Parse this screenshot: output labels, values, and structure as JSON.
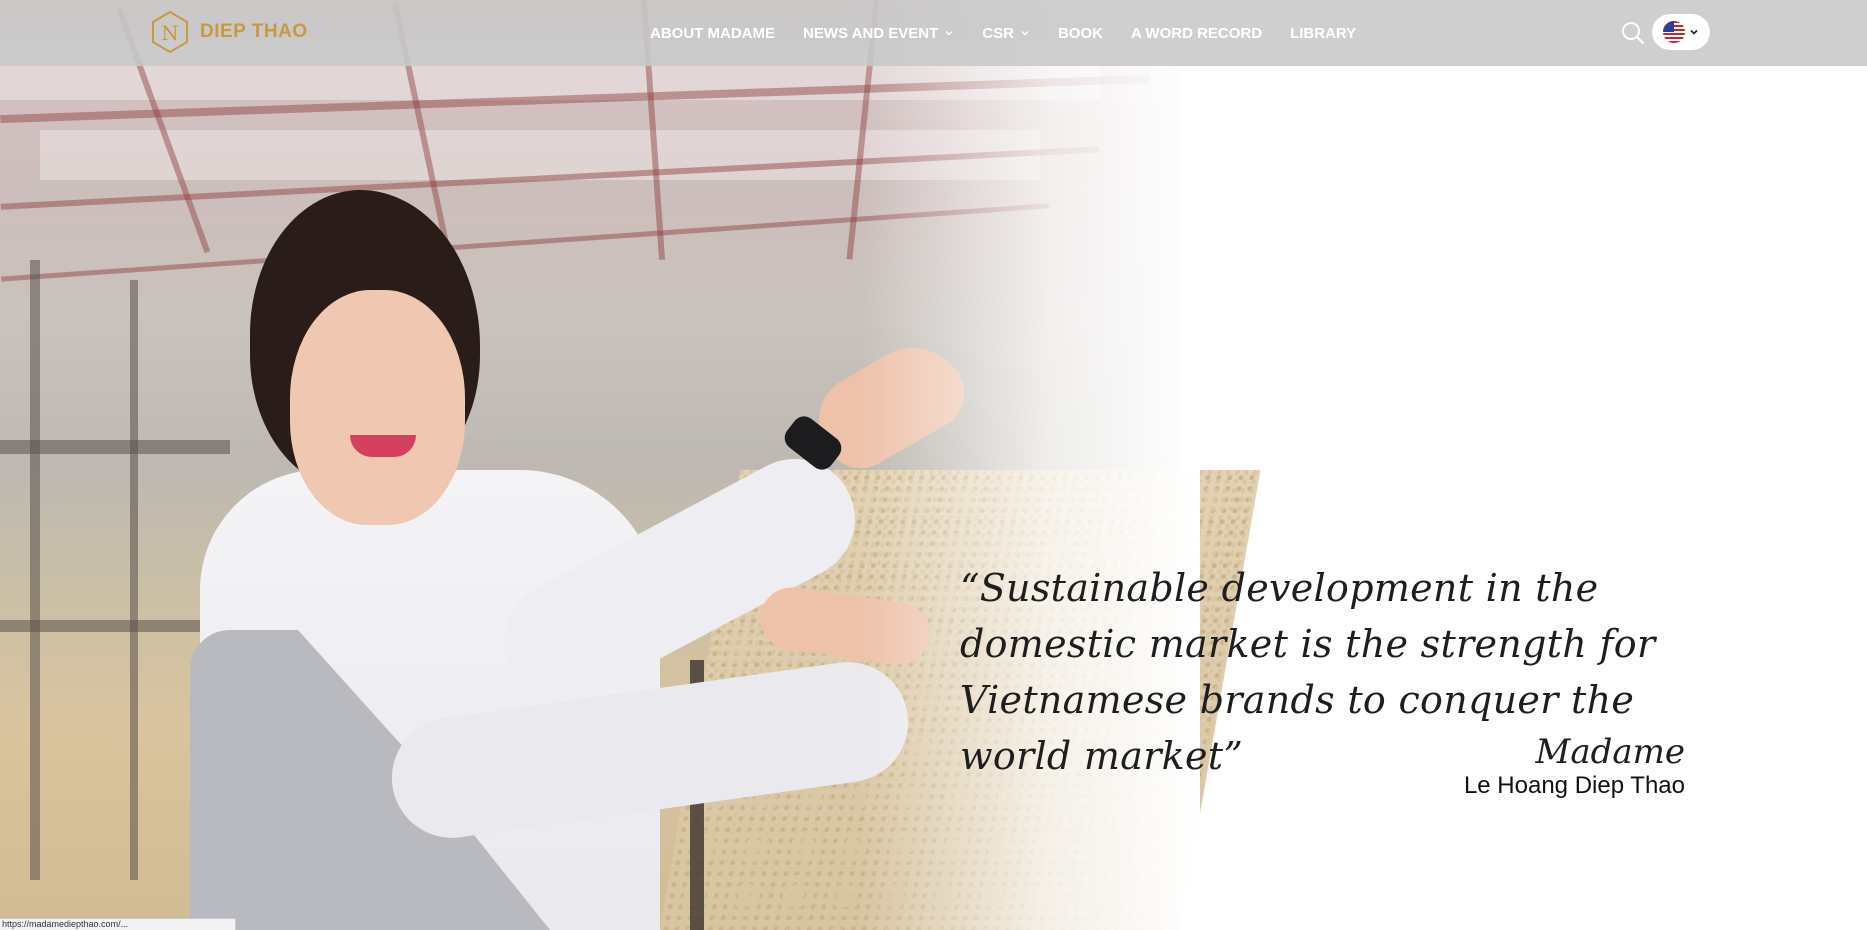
{
  "header": {
    "logo_text": "DIEP THAO",
    "logo_letter": "N",
    "nav": [
      {
        "label": "ABOUT MADAME",
        "has_dropdown": false
      },
      {
        "label": "NEWS AND EVENT",
        "has_dropdown": true
      },
      {
        "label": "CSR",
        "has_dropdown": true
      },
      {
        "label": "BOOK",
        "has_dropdown": false
      },
      {
        "label": "A WORD RECORD",
        "has_dropdown": false
      },
      {
        "label": "LIBRARY",
        "has_dropdown": false
      }
    ],
    "search_icon": "search-icon",
    "language_icon": "us-flag-icon"
  },
  "hero": {
    "quote": "“Sustainable development in the domestic market is the strength for Vietnamese brands to conquer the world market”",
    "sign_title": "Madame",
    "sign_name": "Le Hoang Diep Thao"
  },
  "status_bar": {
    "url": "https://madamediepthao.com/..."
  },
  "colors": {
    "brand_gold": "#c79a3d",
    "header_bg": "#c8c8c8",
    "nav_text": "#ffffff",
    "quote_text": "#1e1e1e"
  }
}
